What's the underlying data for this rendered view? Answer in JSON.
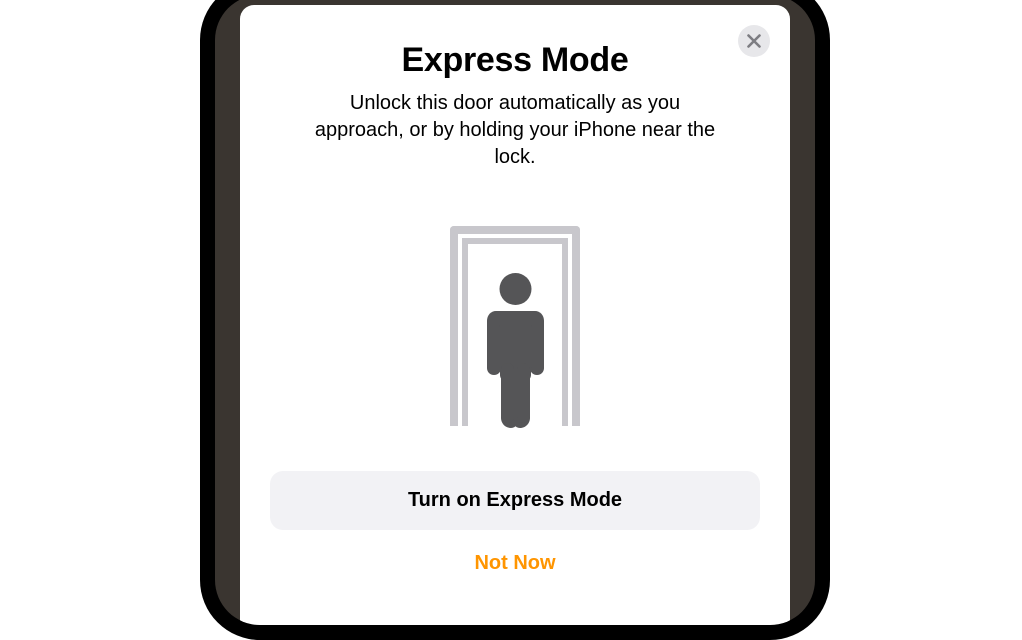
{
  "sheet": {
    "title": "Express Mode",
    "description": "Unlock this door automatically as you approach, or by holding your iPhone near the lock.",
    "primary_button_label": "Turn on Express Mode",
    "secondary_button_label": "Not Now"
  },
  "icons": {
    "close": "close-icon",
    "person_door": "person-in-doorway-icon"
  },
  "colors": {
    "accent": "#ff9500",
    "button_bg": "#f2f2f5",
    "close_bg": "#e7e7ea",
    "door_frame": "#c8c7cc",
    "person": "#555557"
  }
}
